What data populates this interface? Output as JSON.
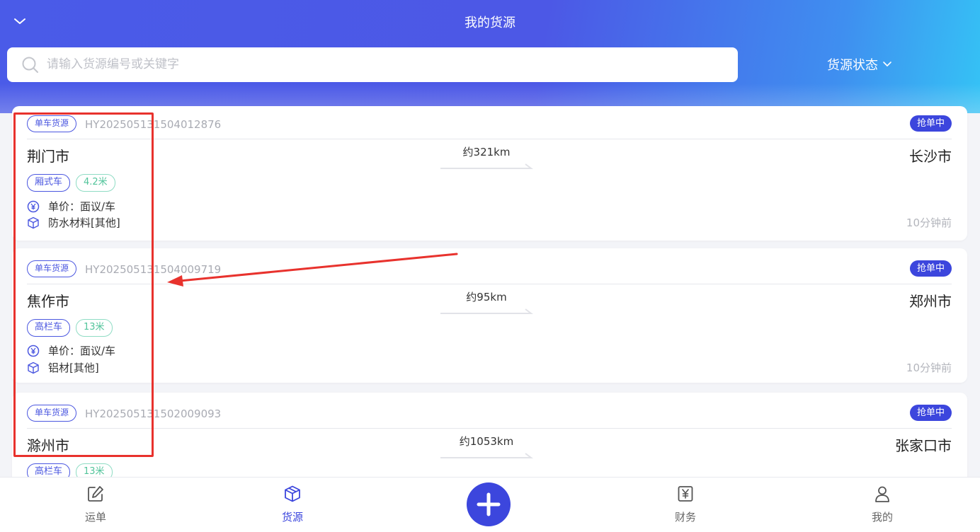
{
  "header": {
    "title": "我的货源",
    "search_placeholder": "请输入货源编号或关键字",
    "status_filter_label": "货源状态"
  },
  "cards": [
    {
      "source_tag": "单车货源",
      "cargo_no": "HY202505131504012876",
      "status": "抢单中",
      "from_city": "荆门市",
      "to_city": "长沙市",
      "distance": "约321km",
      "truck_type": "厢式车",
      "truck_length": "4.2米",
      "price": "单价：面议/车",
      "goods": "防水材料[其他]",
      "time_ago": "10分钟前"
    },
    {
      "source_tag": "单车货源",
      "cargo_no": "HY202505131504009719",
      "status": "抢单中",
      "from_city": "焦作市",
      "to_city": "郑州市",
      "distance": "约95km",
      "truck_type": "高栏车",
      "truck_length": "13米",
      "price": "单价：面议/车",
      "goods": "铝材[其他]",
      "time_ago": "10分钟前"
    },
    {
      "source_tag": "单车货源",
      "cargo_no": "HY202505131502009093",
      "status": "抢单中",
      "from_city": "滁州市",
      "to_city": "张家口市",
      "distance": "约1053km",
      "truck_type": "高栏车",
      "truck_length": "13米"
    }
  ],
  "tabbar": {
    "tabs": [
      {
        "label": "运单",
        "icon": "edit-icon"
      },
      {
        "label": "货源",
        "icon": "box-icon"
      },
      {
        "label": "财务",
        "icon": "yen-icon"
      },
      {
        "label": "我的",
        "icon": "user-icon"
      }
    ],
    "active": "货源",
    "center_icon": "plus-icon"
  },
  "colors": {
    "primary": "#3c46dd",
    "header_gradient_start": "#4a5be8",
    "header_gradient_end": "#35c3f5",
    "annotation_red": "#e8322d",
    "length_tag_green": "#52c49b"
  }
}
